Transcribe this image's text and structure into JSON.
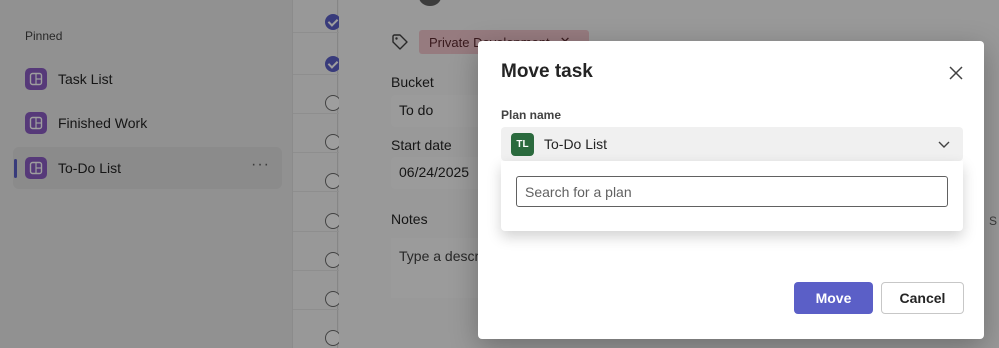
{
  "sidebar": {
    "section_label": "Pinned",
    "items": [
      {
        "label": "Task List",
        "icon": "plan-board-icon"
      },
      {
        "label": "Finished Work",
        "icon": "plan-board-icon"
      },
      {
        "label": "To-Do List",
        "icon": "plan-board-icon",
        "active": true,
        "more": "···"
      }
    ]
  },
  "task_list": {
    "rows": [
      {
        "completed": true
      },
      {
        "completed": true
      },
      {
        "completed": false
      },
      {
        "completed": false
      },
      {
        "completed": false
      },
      {
        "completed": false
      },
      {
        "completed": false
      },
      {
        "completed": false
      },
      {
        "completed": false
      }
    ]
  },
  "detail": {
    "label_chip": "Private Development",
    "bucket_label": "Bucket",
    "bucket_value": "To do",
    "start_date_label": "Start date",
    "start_date_value": "06/24/2025",
    "notes_label": "Notes",
    "notes_placeholder": "Type a descri",
    "right_edge_text": "S"
  },
  "modal": {
    "title": "Move task",
    "plan_name_label": "Plan name",
    "selected_plan": {
      "initials": "TL",
      "name": "To-Do List",
      "badge_color": "#2b6a3e"
    },
    "search_placeholder": "Search for a plan",
    "move_label": "Move",
    "cancel_label": "Cancel"
  },
  "colors": {
    "accent": "#5b5fc7",
    "plan_icon": "#8b5cc4",
    "chip": "#f3c7cd"
  }
}
